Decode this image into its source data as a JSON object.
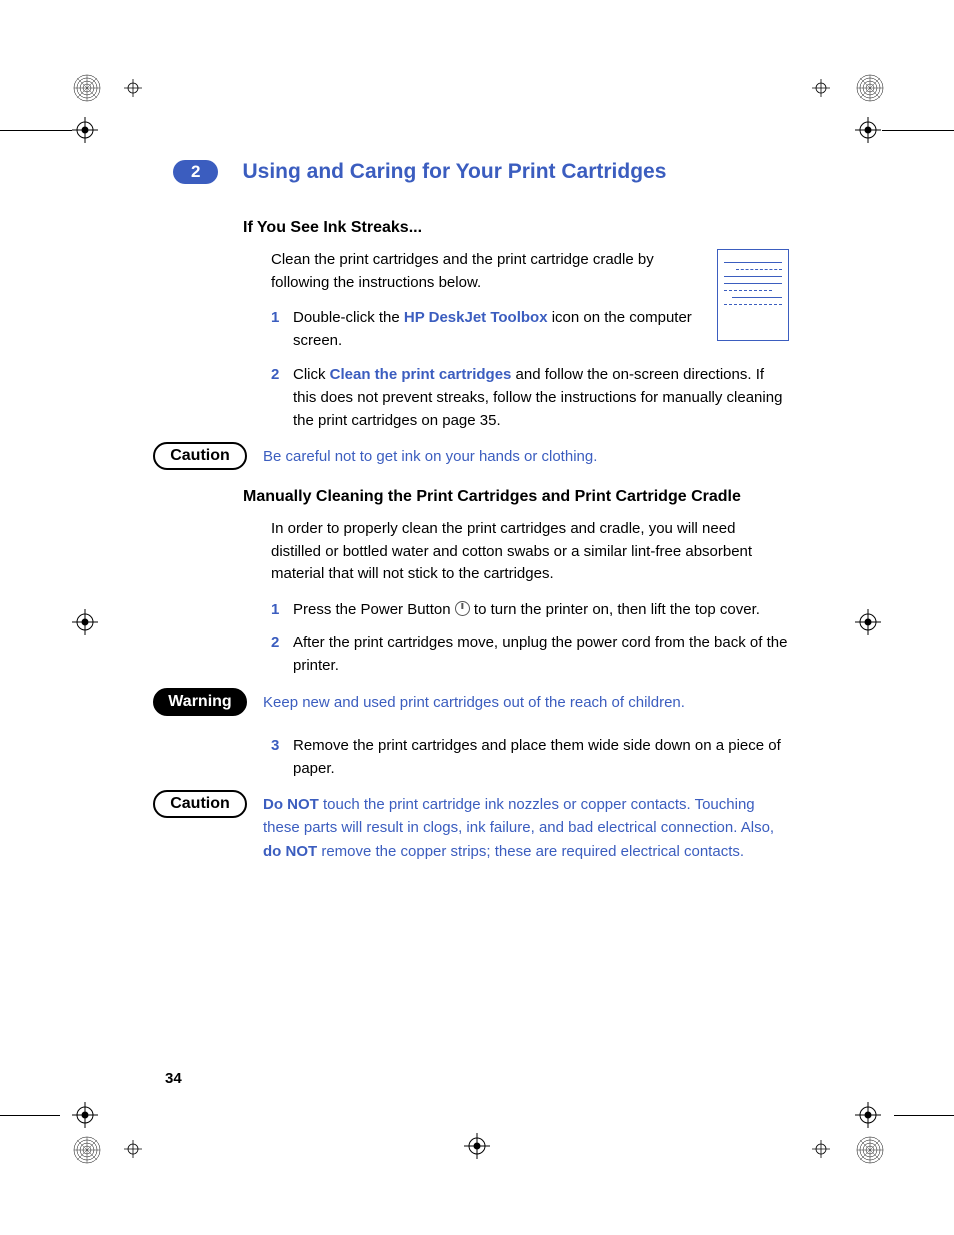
{
  "chapter": {
    "number": "2",
    "title": "Using and Caring for Your Print Cartridges"
  },
  "section1": {
    "heading": "If You See Ink Streaks...",
    "intro": "Clean the print cartridges and the print cartridge cradle by following the instructions below.",
    "step1_a": "Double-click the ",
    "step1_link": "HP DeskJet Toolbox",
    "step1_b": " icon on the computer screen.",
    "step2_a": "Click ",
    "step2_link": "Clean the print cartridges",
    "step2_b": " and follow the on-screen directions. If this does not prevent streaks, follow the instructions for manually cleaning the print cartridges on page 35."
  },
  "caution1": {
    "label": "Caution",
    "text": "Be careful not to get ink on your hands or clothing."
  },
  "section2": {
    "heading": "Manually Cleaning the Print Cartridges and Print Cartridge Cradle",
    "intro": "In order to properly clean the print cartridges and cradle, you will need distilled or bottled water and cotton swabs or a similar lint-free absorbent material that will not stick to the cartridges.",
    "step1_a": "Press the Power Button ",
    "step1_b": " to turn the printer on, then lift the top cover.",
    "step2": "After the print cartridges move, unplug the power cord from the back of the printer."
  },
  "warning": {
    "label": "Warning",
    "text": "Keep new and used print cartridges out of the reach of children."
  },
  "step3": "Remove the print cartridges and place them wide side down on a piece of paper.",
  "caution2": {
    "label": "Caution",
    "strong1": "Do NOT",
    "text1": " touch the print cartridge ink nozzles or copper contacts. Touching these parts will result in clogs, ink failure, and bad electrical connection. Also, ",
    "strong2": "do NOT",
    "text2": " remove the copper strips; these are required electrical contacts."
  },
  "page_number": "34",
  "numbers": {
    "one": "1",
    "two": "2",
    "three": "3"
  }
}
